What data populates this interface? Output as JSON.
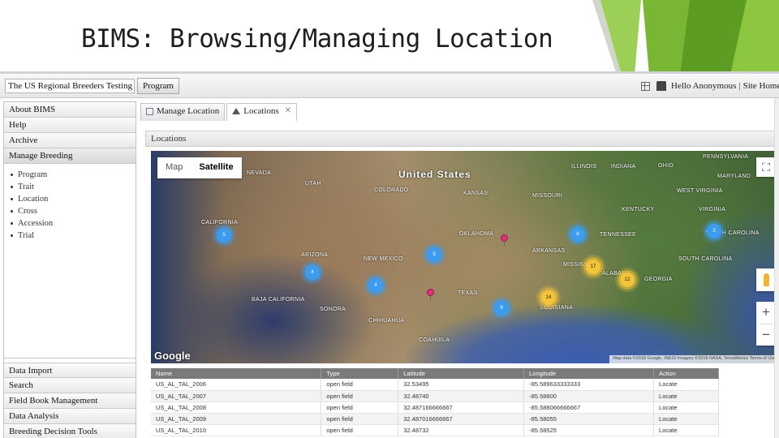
{
  "slide": {
    "title": "BIMS: Browsing/Managing Location"
  },
  "topbar": {
    "app_name": "The US Regional Breeders Testing Net",
    "program_button": "Program",
    "greeting": "Hello Anonymous",
    "separator": "|",
    "site_home": "Site Home"
  },
  "sidebar": {
    "top_items": [
      "About BIMS",
      "Help",
      "Archive",
      "Manage Breeding"
    ],
    "manage_breeding_items": [
      "Program",
      "Trait",
      "Location",
      "Cross",
      "Accession",
      "Trial"
    ],
    "bottom_items": [
      "Data Import",
      "Search",
      "Field Book Management",
      "Data Analysis",
      "Breeding Decision Tools"
    ]
  },
  "tabs": [
    {
      "label": "Manage Location",
      "icon": "window-icon",
      "closable": false
    },
    {
      "label": "Locations",
      "icon": "terrain-icon",
      "closable": true,
      "close": "✕"
    }
  ],
  "panel": {
    "title": "Locations"
  },
  "map": {
    "type_options": [
      "Map",
      "Satellite"
    ],
    "selected_type": "Satellite",
    "country_label": "United States",
    "states": [
      "PENNSYLVANIA",
      "NEVADA",
      "UTAH",
      "COLORADO",
      "KANSAS",
      "ILLINOIS",
      "INDIANA",
      "OHIO",
      "MISSOURI",
      "WEST VIRGINIA",
      "KENTUCKY",
      "VIRGINIA",
      "MARYLAND",
      "CALIFORNIA",
      "OKLAHOMA",
      "TENNESSEE",
      "NORTH CAROLINA",
      "ARKANSAS",
      "ARIZONA",
      "NEW MEXICO",
      "SOUTH CAROLINA",
      "MISSISSIPPI",
      "ALABAMA",
      "GEORGIA",
      "TEXAS",
      "LOUISIANA",
      "BAJA CALIFORNIA",
      "SONORA",
      "CHIHUAHUA",
      "COAHUILA"
    ],
    "clusters": [
      {
        "count": "5",
        "color": "blue"
      },
      {
        "count": "8",
        "color": "blue"
      },
      {
        "count": "3",
        "color": "blue"
      },
      {
        "count": "5",
        "color": "blue"
      },
      {
        "count": "4",
        "color": "blue"
      },
      {
        "count": "4",
        "color": "blue"
      },
      {
        "count": "9",
        "color": "blue"
      },
      {
        "count": "17",
        "color": "yellow"
      },
      {
        "count": "12",
        "color": "yellow"
      },
      {
        "count": "14",
        "color": "yellow"
      }
    ],
    "fullscreen_icon": "⛶",
    "zoom_in": "+",
    "zoom_out": "−",
    "google": "Google",
    "attribution": "Map data ©2018 Google, INEGI Imagery ©2018 NASA, TerraMetrics   Terms of Use"
  },
  "table": {
    "headers": [
      "Name",
      "Type",
      "Latitude",
      "Longitude",
      "Action"
    ],
    "rows": [
      [
        "US_AL_TAL_2006",
        "open field",
        "32.53495",
        "-85.589633333333",
        "Locate"
      ],
      [
        "US_AL_TAL_2007",
        "open field",
        "32.48740",
        "-85.58800",
        "Locate"
      ],
      [
        "US_AL_TAL_2008",
        "open field",
        "32.487166666667",
        "-85.588066666667",
        "Locate"
      ],
      [
        "US_AL_TAL_2009",
        "open field",
        "32.487016666667",
        "-85.58055",
        "Locate"
      ],
      [
        "US_AL_TAL_2010",
        "open field",
        "32.48732",
        "-85.58525",
        "Locate"
      ]
    ]
  }
}
